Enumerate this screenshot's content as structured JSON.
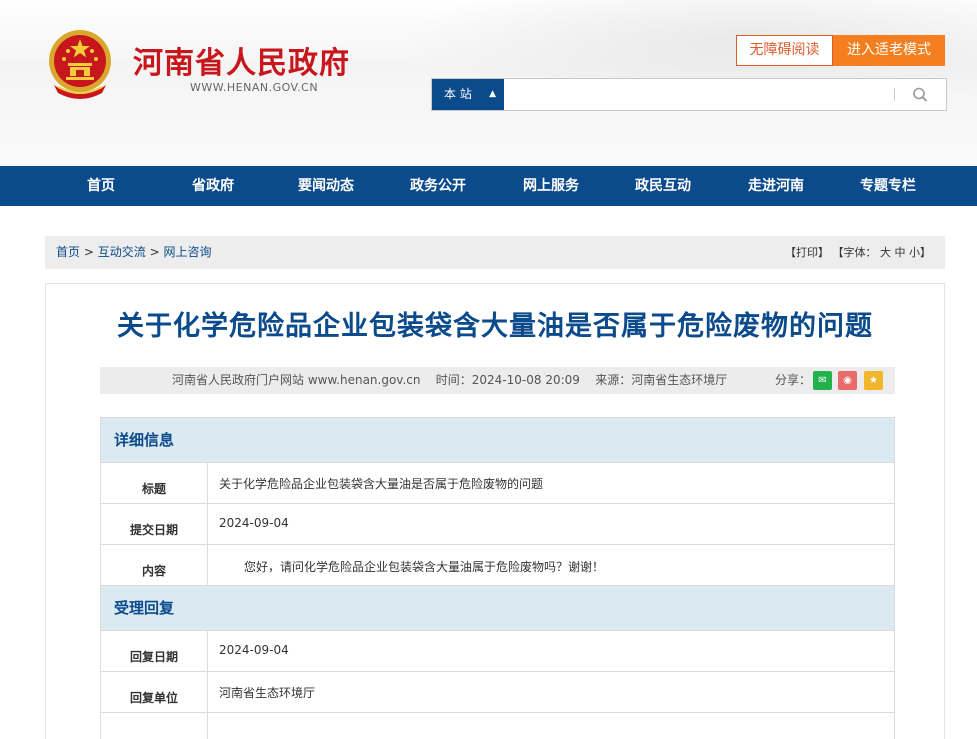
{
  "header": {
    "site_title": "河南省人民政府",
    "site_domain": "WWW.HENAN.GOV.CN",
    "accessible_label": "无障碍阅读",
    "elder_mode_label": "进入适老模式",
    "search": {
      "scope": "本 站",
      "placeholder": ""
    }
  },
  "nav": {
    "items": [
      "首页",
      "省政府",
      "要闻动态",
      "政务公开",
      "网上服务",
      "政民互动",
      "走进河南",
      "专题专栏"
    ]
  },
  "breadcrumb": {
    "items": [
      "首页",
      "互动交流",
      "网上咨询"
    ],
    "separator": ">",
    "print": "【打印】",
    "font_label": "【字体：",
    "font_large": "大",
    "font_medium": "中",
    "font_small": "小",
    "font_close": "】"
  },
  "article": {
    "title": "关于化学危险品企业包装袋含大量油是否属于危险废物的问题",
    "source_site": "河南省人民政府门户网站 www.henan.gov.cn",
    "time_label": "时间：",
    "time": "2024-10-08 20:09",
    "origin_label": "来源：",
    "origin": "河南省生态环境厅",
    "share_label": "分享："
  },
  "detail": {
    "section_title": "详细信息",
    "rows": [
      {
        "key": "标题",
        "value": "关于化学危险品企业包装袋含大量油是否属于危险废物的问题"
      },
      {
        "key": "提交日期",
        "value": "2024-09-04"
      },
      {
        "key": "内容",
        "value": "您好，请问化学危险品企业包装袋含大量油属于危险废物吗？谢谢！"
      }
    ]
  },
  "reply": {
    "section_title": "受理回复",
    "rows": [
      {
        "key": "回复日期",
        "value": "2024-09-04"
      },
      {
        "key": "回复单位",
        "value": "河南省生态环境厅"
      }
    ]
  },
  "colors": {
    "brand_blue": "#0b4a8b",
    "brand_red": "#c8161d",
    "orange": "#f57e1f",
    "section_bg": "#dbe9f2"
  }
}
